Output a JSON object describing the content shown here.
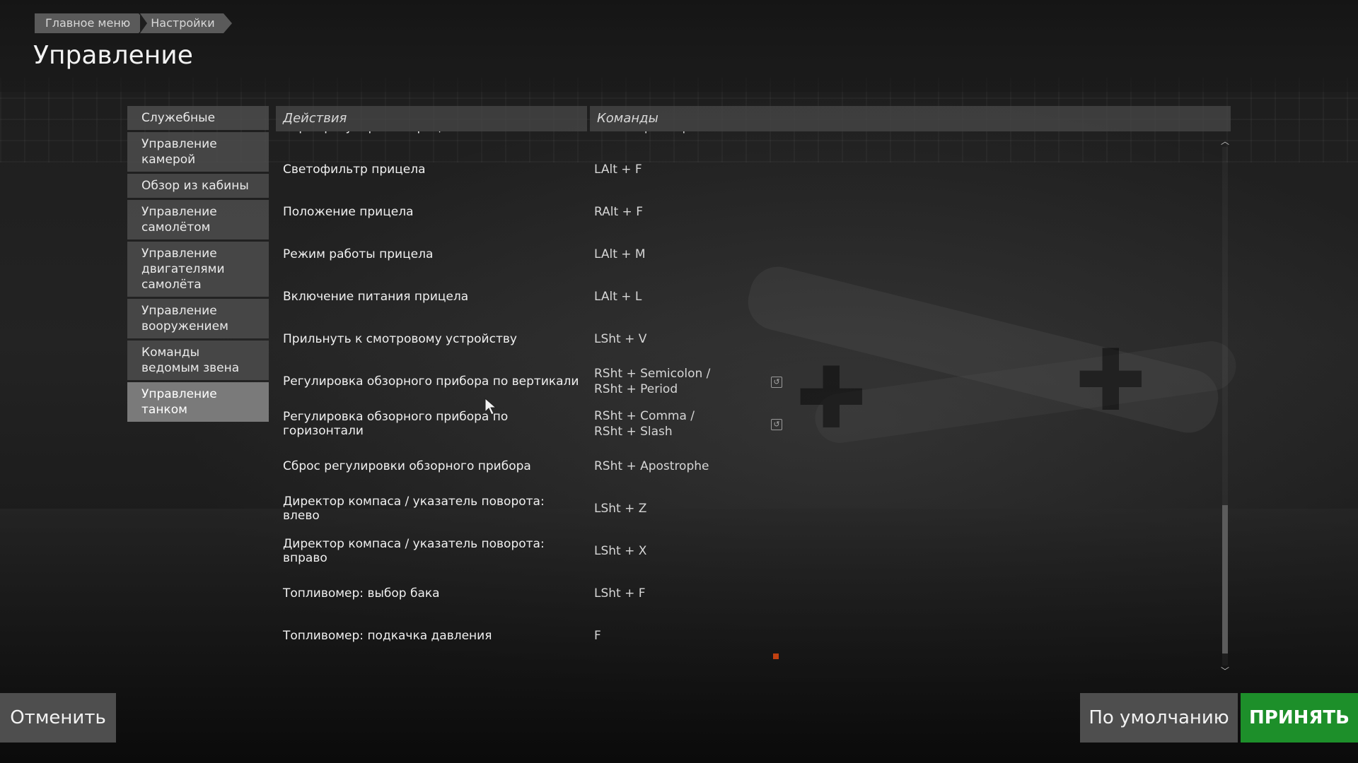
{
  "breadcrumb": [
    "Главное меню",
    "Настройки"
  ],
  "title": "Управление",
  "sidebar": {
    "items": [
      {
        "label": "Служебные"
      },
      {
        "label": "Управление камерой"
      },
      {
        "label": "Обзор из кабины"
      },
      {
        "label": "Управление самолётом"
      },
      {
        "label": "Управление двигателями самолёта"
      },
      {
        "label": "Управление вооружением"
      },
      {
        "label": "Команды ведомым звена"
      },
      {
        "label": "Управление танком"
      }
    ],
    "active": "Управление танком"
  },
  "table": {
    "headers": {
      "actions": "Действия",
      "commands": "Команды"
    },
    "rows": [
      {
        "action": "Сброс регулировки прицела",
        "command": [
          "RAlt + Apostrophe"
        ]
      },
      {
        "action": "Светофильтр прицела",
        "command": [
          "LAlt + F"
        ]
      },
      {
        "action": "Положение прицела",
        "command": [
          "RAlt + F"
        ]
      },
      {
        "action": "Режим работы прицела",
        "command": [
          "LAlt + M"
        ]
      },
      {
        "action": "Включение питания прицела",
        "command": [
          "LAlt + L"
        ]
      },
      {
        "action": "Прильнуть к смотровому устройству",
        "command": [
          "LSht + V"
        ]
      },
      {
        "action": "Регулировка обзорного прибора по вертикали",
        "command": [
          "RSht + Semicolon /",
          "RSht + Period"
        ],
        "reset_icon": true
      },
      {
        "action": "Регулировка обзорного прибора по горизонтали",
        "command": [
          "RSht + Comma /",
          "RSht + Slash"
        ],
        "reset_icon": true
      },
      {
        "action": "Сброс регулировки обзорного прибора",
        "command": [
          "RSht + Apostrophe"
        ]
      },
      {
        "action": "Директор компаса / указатель поворота: влево",
        "command": [
          "LSht + Z"
        ]
      },
      {
        "action": "Директор компаса / указатель поворота: вправо",
        "command": [
          "LSht + X"
        ]
      },
      {
        "action": "Топливомер: выбор бака",
        "command": [
          "LSht + F"
        ]
      },
      {
        "action": "Топливомер: подкачка давления",
        "command": [
          "F"
        ]
      }
    ]
  },
  "buttons": {
    "cancel": "Отменить",
    "default": "По умолчанию",
    "accept": "ПРИНЯТЬ"
  },
  "colors": {
    "accept": "#1d8f2a",
    "panel": "#4e4e4e",
    "active_item": "#7a7a7a"
  },
  "scroll": {
    "position": 0.72
  }
}
